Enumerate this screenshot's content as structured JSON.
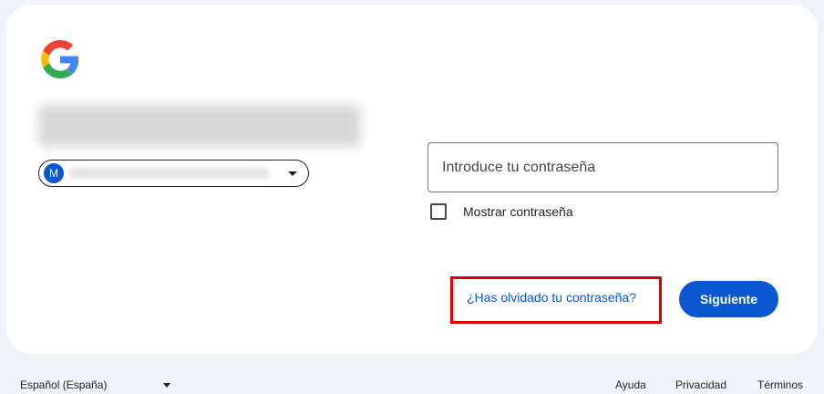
{
  "login": {
    "password_placeholder": "Introduce tu contraseña",
    "show_password_label": "Mostrar contraseña",
    "forgot_password_label": "¿Has olvidado tu contraseña?",
    "next_button_label": "Siguiente",
    "account_avatar_initial": "M"
  },
  "footer": {
    "language": "Español (España)",
    "help": "Ayuda",
    "privacy": "Privacidad",
    "terms": "Términos"
  },
  "colors": {
    "primary": "#0b57d0",
    "highlight_box": "#e00000",
    "background": "#f0f4f9"
  },
  "icons": [
    "google-logo",
    "chevron-down-icon",
    "checkbox-icon"
  ]
}
